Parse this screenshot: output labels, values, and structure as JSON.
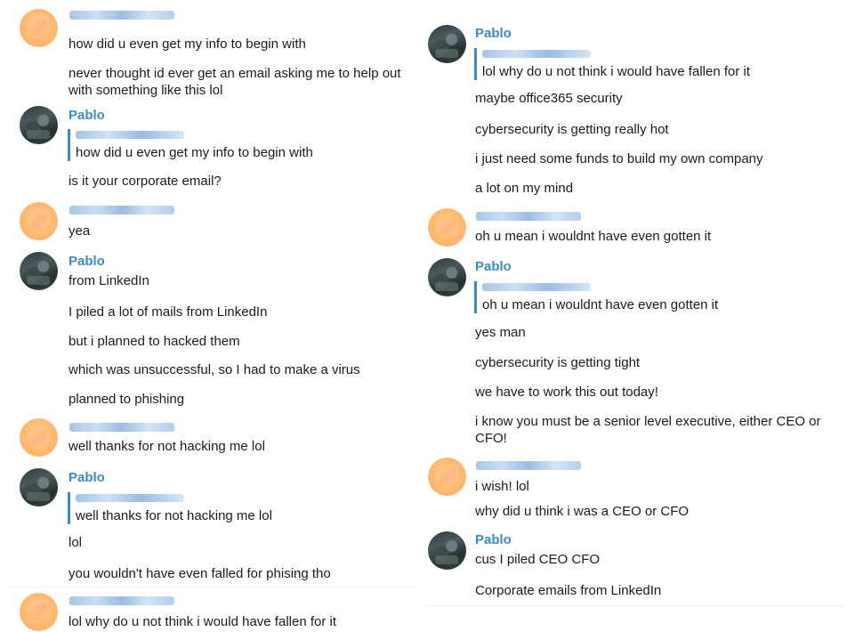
{
  "left": {
    "blocks": [
      {
        "sender": "",
        "lines": [
          "how did u even get my info to begin with",
          "never thought id ever get an email asking me to help out with something like this lol"
        ]
      },
      {
        "sender": "Pablo",
        "quote": "how did u even get my info to begin with",
        "lines": [
          "is it your corporate email?"
        ]
      },
      {
        "sender": "",
        "lines": [
          "yea"
        ]
      },
      {
        "sender": "Pablo",
        "lines": [
          "from LinkedIn",
          "I piled a lot of mails from LinkedIn",
          "but i planned to hacked them",
          "which was unsuccessful, so I had to make a virus",
          "planned to phishing"
        ]
      },
      {
        "sender": "",
        "lines": [
          "well thanks for not hacking me lol"
        ]
      },
      {
        "sender": "Pablo",
        "quote": "well thanks for not hacking me lol",
        "lines": [
          "lol",
          "you wouldn't have even falled for phising tho"
        ]
      },
      {
        "sender": "",
        "lines": [
          "lol why do u not think i would have fallen for it"
        ]
      }
    ]
  },
  "right": {
    "blocks": [
      {
        "sender": "Pablo",
        "quote": "lol why do u not think i would have fallen for it",
        "lines": [
          "maybe office365 security",
          "cybersecurity is getting really hot",
          "i just need some funds to build my own company",
          "a lot on my mind"
        ]
      },
      {
        "sender": "",
        "lines": [
          "oh u mean i wouldnt have even gotten it"
        ]
      },
      {
        "sender": "Pablo",
        "quote": "oh u mean i wouldnt have even gotten it",
        "lines": [
          "yes man",
          "cybersecurity is getting tight",
          "we have to work this out today!",
          "i know you must be a senior level executive, either CEO or CFO!"
        ]
      },
      {
        "sender": "",
        "lines": [
          "i wish! lol",
          "why did u think i was a CEO or CFO"
        ]
      },
      {
        "sender": "Pablo",
        "lines": [
          "cus I piled CEO CFO",
          "Corporate emails from LinkedIn"
        ]
      }
    ]
  },
  "colors": {
    "accent": "#3a8bc9",
    "text": "#1b1b1b",
    "other_avatar": "#ffb26b"
  }
}
